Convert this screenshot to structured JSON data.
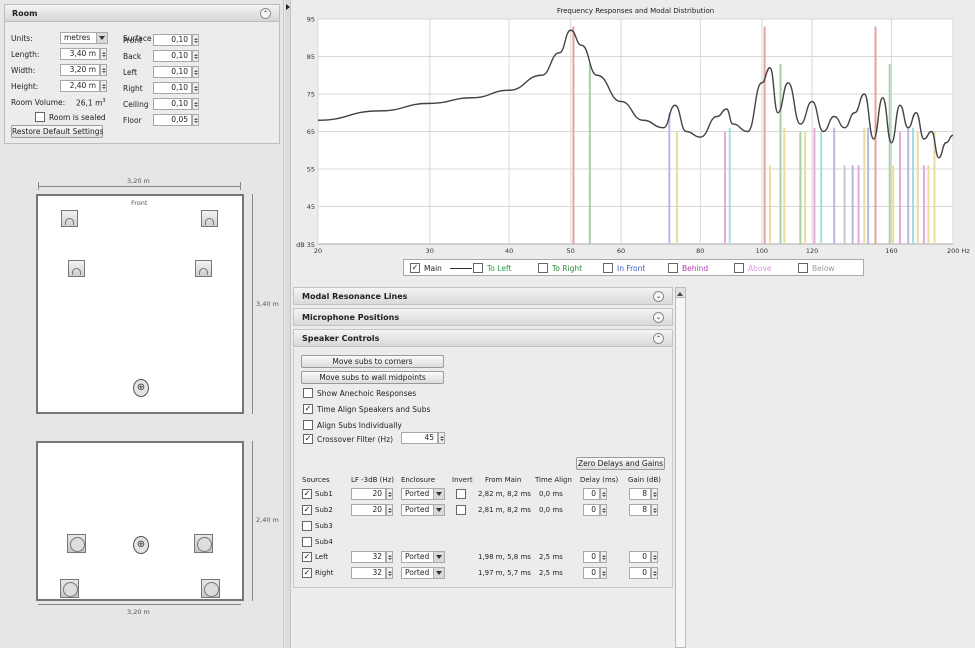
{
  "room_panel": {
    "title": "Room",
    "units_label": "Units:",
    "units_value": "metres",
    "length_label": "Length:",
    "length_value": "3,40 m",
    "width_label": "Width:",
    "width_value": "3,20 m",
    "height_label": "Height:",
    "height_value": "2,40 m",
    "volume_label": "Room Volume:",
    "volume_value": "26,1 m",
    "volume_unit_sup": "3",
    "sealed_label": "Room is sealed",
    "restore_button": "Restore Default Settings",
    "absorptions_title": "Surface Absorptions",
    "surfaces": [
      {
        "label": "Front",
        "value": "0,10"
      },
      {
        "label": "Back",
        "value": "0,10"
      },
      {
        "label": "Left",
        "value": "0,10"
      },
      {
        "label": "Right",
        "value": "0,10"
      },
      {
        "label": "Ceiling",
        "value": "0,10"
      },
      {
        "label": "Floor",
        "value": "0,05"
      }
    ]
  },
  "plan_view": {
    "width_dim": "3,20 m",
    "length_dim": "3,40 m",
    "front_label": "Front"
  },
  "elevation_view": {
    "height_dim": "2,40 m",
    "width_dim": "3,20 m"
  },
  "chart_data": {
    "type": "line",
    "title": "Frequency Responses and Modal Distribution",
    "xscale": "log",
    "xlim": [
      20,
      200
    ],
    "ylim": [
      35,
      95
    ],
    "xticks": [
      20,
      30,
      40,
      50,
      60,
      80,
      100,
      120,
      160,
      200
    ],
    "xtick_labels": [
      "20",
      "30",
      "40",
      "50",
      "60",
      "80",
      "100",
      "120",
      "160",
      "200 Hz"
    ],
    "yticks": [
      45,
      55,
      65,
      75,
      85,
      95
    ],
    "ytick_labels": [
      "45",
      "55",
      "65",
      "75",
      "85",
      "95"
    ],
    "ybottom_label": "dB 35",
    "grid": true,
    "series": [
      {
        "name": "Main",
        "color": "#444444",
        "x": [
          20,
          25,
          30,
          35,
          40,
          45,
          48,
          50,
          52,
          55,
          60,
          65,
          70,
          73,
          76,
          80,
          85,
          88,
          90,
          95,
          100,
          103,
          106,
          110,
          115,
          120,
          125,
          130,
          135,
          140,
          145,
          150,
          155,
          160,
          165,
          170,
          175,
          180,
          185,
          190,
          195,
          200
        ],
        "y": [
          68,
          70.5,
          72.5,
          74,
          76,
          80,
          86,
          92,
          88,
          80,
          73,
          68,
          66,
          72,
          65,
          63.5,
          69,
          71,
          67,
          65,
          78,
          82,
          70,
          78,
          67,
          73,
          65,
          69,
          66,
          70,
          75,
          63,
          74,
          62,
          72,
          66,
          70,
          63,
          65,
          58,
          62,
          64
        ]
      }
    ],
    "modal_lines": [
      {
        "x": 50.5,
        "height": 93,
        "color": "#e8a0a0"
      },
      {
        "x": 53.6,
        "height": 83,
        "color": "#a8d0a8"
      },
      {
        "x": 71.5,
        "height": 70,
        "color": "#b8b8e8"
      },
      {
        "x": 73.5,
        "height": 65,
        "color": "#e8dca0"
      },
      {
        "x": 87.5,
        "height": 65,
        "color": "#e8a8d8"
      },
      {
        "x": 89.0,
        "height": 66,
        "color": "#a8dde0"
      },
      {
        "x": 101,
        "height": 93,
        "color": "#e8a0a0"
      },
      {
        "x": 103,
        "height": 56,
        "color": "#e8dca0"
      },
      {
        "x": 107,
        "height": 83,
        "color": "#a8d0a8"
      },
      {
        "x": 108.5,
        "height": 66,
        "color": "#e8dca0"
      },
      {
        "x": 115,
        "height": 65,
        "color": "#a8d0a8"
      },
      {
        "x": 117,
        "height": 65,
        "color": "#e8dca0"
      },
      {
        "x": 121,
        "height": 66,
        "color": "#e8a8d8"
      },
      {
        "x": 124,
        "height": 65,
        "color": "#a8dde0"
      },
      {
        "x": 130,
        "height": 66,
        "color": "#b8b8e8"
      },
      {
        "x": 135,
        "height": 56,
        "color": "#c8c8c8"
      },
      {
        "x": 139,
        "height": 56,
        "color": "#b8b8e8"
      },
      {
        "x": 142,
        "height": 56,
        "color": "#e8a8d8"
      },
      {
        "x": 145,
        "height": 66,
        "color": "#e8dca0"
      },
      {
        "x": 147,
        "height": 66,
        "color": "#b8b8e8"
      },
      {
        "x": 151,
        "height": 93,
        "color": "#e8a0a0"
      },
      {
        "x": 159,
        "height": 83,
        "color": "#a8d0a8"
      },
      {
        "x": 161,
        "height": 56,
        "color": "#e8dca0"
      },
      {
        "x": 165,
        "height": 65,
        "color": "#e8a8d8"
      },
      {
        "x": 170,
        "height": 66,
        "color": "#b8b8e8"
      },
      {
        "x": 173,
        "height": 66,
        "color": "#a8dde0"
      },
      {
        "x": 176,
        "height": 65,
        "color": "#e8dca0"
      },
      {
        "x": 180,
        "height": 56,
        "color": "#e8a8d8"
      },
      {
        "x": 183,
        "height": 56,
        "color": "#e8dca0"
      },
      {
        "x": 187,
        "height": 65,
        "color": "#e8dca0"
      }
    ]
  },
  "legend": [
    {
      "label": "Main",
      "checked": true,
      "color": "#222222"
    },
    {
      "label": "To Left",
      "checked": false,
      "color": "#2a9a4a"
    },
    {
      "label": "To Right",
      "checked": false,
      "color": "#2a8a3a"
    },
    {
      "label": "In Front",
      "checked": false,
      "color": "#3a5abf"
    },
    {
      "label": "Behind",
      "checked": false,
      "color": "#b03ab0"
    },
    {
      "label": "Above",
      "checked": false,
      "color": "#d89ad8"
    },
    {
      "label": "Below",
      "checked": false,
      "color": "#999999"
    }
  ],
  "sections": {
    "modal": "Modal Resonance Lines",
    "mics": "Microphone Positions",
    "speakers": "Speaker Controls"
  },
  "speaker_controls": {
    "move_corners": "Move subs to corners",
    "move_midpoints": "Move subs to wall midpoints",
    "show_anechoic": "Show Anechoic Responses",
    "time_align": "Time Align Speakers and Subs",
    "align_individually": "Align Subs Individually",
    "crossover": "Crossover Filter (Hz)",
    "crossover_value": "45",
    "zero_button": "Zero Delays and Gains",
    "headers": {
      "sources": "Sources",
      "lf": "LF -3dB (Hz)",
      "enclosure": "Enclosure",
      "invert": "Invert",
      "from_main": "From Main",
      "time_align": "Time Align",
      "delay": "Delay (ms)",
      "gain": "Gain (dB)"
    },
    "rows": [
      {
        "name": "Sub1",
        "checked": true,
        "lf": "20",
        "enclosure": "Ported",
        "invert": true,
        "from_main": "2,82 m, 8,2 ms",
        "time_align": "0,0 ms",
        "delay": "0",
        "gain": "8"
      },
      {
        "name": "Sub2",
        "checked": true,
        "lf": "20",
        "enclosure": "Ported",
        "invert": true,
        "from_main": "2,81 m, 8,2 ms",
        "time_align": "0,0 ms",
        "delay": "0",
        "gain": "8"
      },
      {
        "name": "Sub3",
        "checked": false
      },
      {
        "name": "Sub4",
        "checked": false
      },
      {
        "name": "Left",
        "checked": true,
        "lf": "32",
        "enclosure": "Ported",
        "invert": false,
        "from_main": "1,98 m, 5,8 ms",
        "time_align": "2,5 ms",
        "delay": "0",
        "gain": "0"
      },
      {
        "name": "Right",
        "checked": true,
        "lf": "32",
        "enclosure": "Ported",
        "invert": false,
        "from_main": "1,97 m, 5,7 ms",
        "time_align": "2,5 ms",
        "delay": "0",
        "gain": "0"
      }
    ]
  }
}
